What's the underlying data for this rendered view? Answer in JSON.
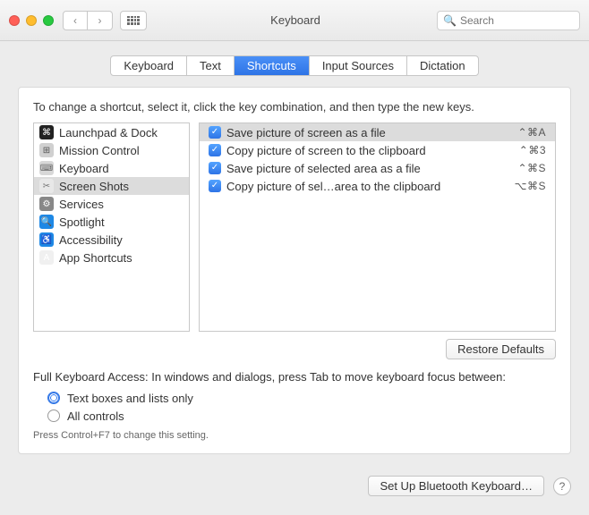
{
  "window": {
    "title": "Keyboard"
  },
  "search": {
    "placeholder": "Search"
  },
  "tabs": [
    "Keyboard",
    "Text",
    "Shortcuts",
    "Input Sources",
    "Dictation"
  ],
  "active_tab": 2,
  "instruction": "To change a shortcut, select it, click the key combination, and then type the new keys.",
  "categories": [
    {
      "label": "Launchpad & Dock",
      "icon": "launchpad"
    },
    {
      "label": "Mission Control",
      "icon": "mission"
    },
    {
      "label": "Keyboard",
      "icon": "keyboard"
    },
    {
      "label": "Screen Shots",
      "icon": "screen"
    },
    {
      "label": "Services",
      "icon": "services"
    },
    {
      "label": "Spotlight",
      "icon": "spotlight"
    },
    {
      "label": "Accessibility",
      "icon": "access"
    },
    {
      "label": "App Shortcuts",
      "icon": "apps"
    }
  ],
  "selected_category": 3,
  "shortcuts": [
    {
      "checked": true,
      "label": "Save picture of screen as a file",
      "keys": "⌃⌘A"
    },
    {
      "checked": true,
      "label": "Copy picture of screen to the clipboard",
      "keys": "⌃⌘3"
    },
    {
      "checked": true,
      "label": "Save picture of selected area as a file",
      "keys": "⌃⌘S"
    },
    {
      "checked": true,
      "label": "Copy picture of sel…area to the clipboard",
      "keys": "⌥⌘S"
    }
  ],
  "selected_shortcut": 0,
  "restore_label": "Restore Defaults",
  "fka": {
    "label": "Full Keyboard Access: In windows and dialogs, press Tab to move keyboard focus between:",
    "options": [
      "Text boxes and lists only",
      "All controls"
    ],
    "selected": 0,
    "hint": "Press Control+F7 to change this setting."
  },
  "bottom": {
    "bluetooth_label": "Set Up Bluetooth Keyboard…"
  }
}
